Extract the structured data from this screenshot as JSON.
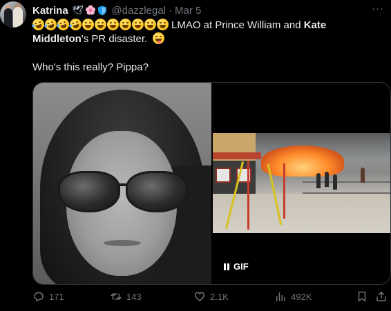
{
  "tweet": {
    "author": {
      "name": "Katrina",
      "badges": {
        "dove": "🕊",
        "flower": "🌸",
        "shield_icon": "shield-icon"
      },
      "handle": "@dazzlegal",
      "separator": "·",
      "date": "Mar 5"
    },
    "more_label": "···",
    "text": {
      "line1_main": "LMAO at Prince William and ",
      "line1_bold": "Kate",
      "line2_bold": "Middleton",
      "line2_rest": "'s PR disaster.",
      "question": "Who's this really? Pippa?"
    },
    "media": {
      "gif_label": "GIF"
    },
    "actions": {
      "replies": "171",
      "reposts": "143",
      "likes": "2.1K",
      "views": "492K"
    },
    "colors": {
      "background": "#000000",
      "text": "#e7e9ea",
      "muted": "#71767b",
      "border": "#2f3336",
      "verified_blue": "#1d9bf0"
    }
  }
}
